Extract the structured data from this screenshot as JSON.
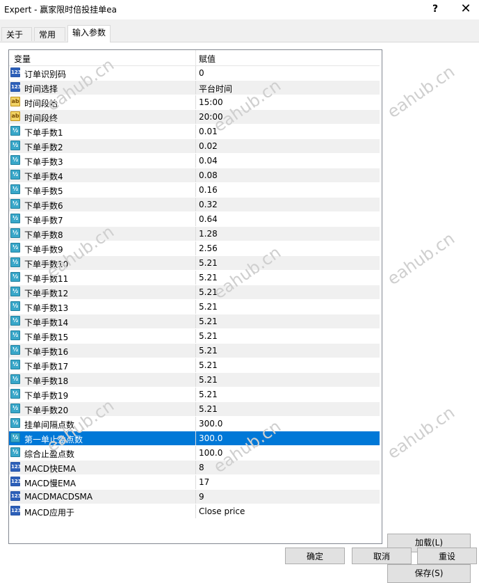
{
  "window": {
    "title": "Expert - 赢家限时倍投挂单ea",
    "help_label": "?",
    "close_label": "✕"
  },
  "tabs": [
    {
      "label": "关于",
      "active": false
    },
    {
      "label": "常用",
      "active": false
    },
    {
      "label": "输入参数",
      "active": true
    }
  ],
  "grid": {
    "col_variable": "变量",
    "col_value": "赋值",
    "rows": [
      {
        "icon": "int",
        "name": "订单识别码",
        "value": "0"
      },
      {
        "icon": "int",
        "name": "时间选择",
        "value": "平台时间"
      },
      {
        "icon": "str",
        "name": "时间段始",
        "value": "15:00"
      },
      {
        "icon": "str",
        "name": "时间段终",
        "value": "20:00"
      },
      {
        "icon": "dbl",
        "name": "下单手数1",
        "value": "0.01"
      },
      {
        "icon": "dbl",
        "name": "下单手数2",
        "value": "0.02"
      },
      {
        "icon": "dbl",
        "name": "下单手数3",
        "value": "0.04"
      },
      {
        "icon": "dbl",
        "name": "下单手数4",
        "value": "0.08"
      },
      {
        "icon": "dbl",
        "name": "下单手数5",
        "value": "0.16"
      },
      {
        "icon": "dbl",
        "name": "下单手数6",
        "value": "0.32"
      },
      {
        "icon": "dbl",
        "name": "下单手数7",
        "value": "0.64"
      },
      {
        "icon": "dbl",
        "name": "下单手数8",
        "value": "1.28"
      },
      {
        "icon": "dbl",
        "name": "下单手数9",
        "value": "2.56"
      },
      {
        "icon": "dbl",
        "name": "下单手数10",
        "value": "5.21"
      },
      {
        "icon": "dbl",
        "name": "下单手数11",
        "value": "5.21"
      },
      {
        "icon": "dbl",
        "name": "下单手数12",
        "value": "5.21"
      },
      {
        "icon": "dbl",
        "name": "下单手数13",
        "value": "5.21"
      },
      {
        "icon": "dbl",
        "name": "下单手数14",
        "value": "5.21"
      },
      {
        "icon": "dbl",
        "name": "下单手数15",
        "value": "5.21"
      },
      {
        "icon": "dbl",
        "name": "下单手数16",
        "value": "5.21"
      },
      {
        "icon": "dbl",
        "name": "下单手数17",
        "value": "5.21"
      },
      {
        "icon": "dbl",
        "name": "下单手数18",
        "value": "5.21"
      },
      {
        "icon": "dbl",
        "name": "下单手数19",
        "value": "5.21"
      },
      {
        "icon": "dbl",
        "name": "下单手数20",
        "value": "5.21"
      },
      {
        "icon": "dbl",
        "name": "挂单间隔点数",
        "value": "300.0"
      },
      {
        "icon": "dbl",
        "name": "第一单止盈点数",
        "value": "300.0",
        "selected": true
      },
      {
        "icon": "dbl",
        "name": "综合止盈点数",
        "value": "100.0"
      },
      {
        "icon": "int",
        "name": "MACD快EMA",
        "value": "8"
      },
      {
        "icon": "int",
        "name": "MACD慢EMA",
        "value": "17"
      },
      {
        "icon": "int",
        "name": "MACDMACDSMA",
        "value": "9"
      },
      {
        "icon": "int",
        "name": "MACD应用于",
        "value": "Close price"
      }
    ]
  },
  "icons": {
    "int": "123",
    "str": "ab",
    "dbl": "½"
  },
  "buttons": {
    "load": "加载(L)",
    "save": "保存(S)",
    "ok": "确定",
    "cancel": "取消",
    "reset": "重设"
  },
  "watermark": "eahub.cn",
  "colors": {
    "selection": "#0078d7",
    "alt_row": "#f0f0f0"
  }
}
